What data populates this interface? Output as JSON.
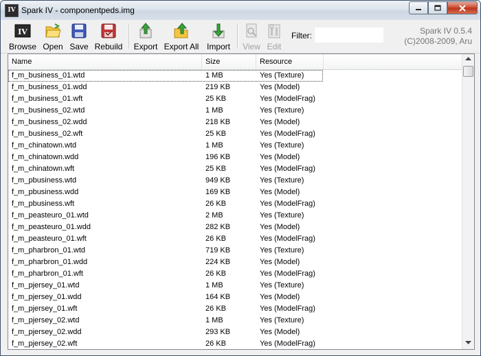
{
  "window": {
    "title": "Spark IV - componentpeds.img",
    "app_icon_text": "IV"
  },
  "toolbar": {
    "browse": "Browse",
    "open": "Open",
    "save": "Save",
    "rebuild": "Rebuild",
    "export": "Export",
    "export_all": "Export All",
    "import": "Import",
    "view": "View",
    "edit": "Edit",
    "filter_label": "Filter:",
    "filter_value": "",
    "version_line1": "Spark IV 0.5.4",
    "version_line2": "(C)2008-2009, Aru"
  },
  "columns": {
    "name": "Name",
    "size": "Size",
    "resource": "Resource"
  },
  "rows": [
    {
      "name": "f_m_business_01.wtd",
      "size": "1 MB",
      "resource": "Yes (Texture)"
    },
    {
      "name": "f_m_business_01.wdd",
      "size": "219 KB",
      "resource": "Yes (Model)"
    },
    {
      "name": "f_m_business_01.wft",
      "size": "25 KB",
      "resource": "Yes (ModelFrag)"
    },
    {
      "name": "f_m_business_02.wtd",
      "size": "1 MB",
      "resource": "Yes (Texture)"
    },
    {
      "name": "f_m_business_02.wdd",
      "size": "218 KB",
      "resource": "Yes (Model)"
    },
    {
      "name": "f_m_business_02.wft",
      "size": "25 KB",
      "resource": "Yes (ModelFrag)"
    },
    {
      "name": "f_m_chinatown.wtd",
      "size": "1 MB",
      "resource": "Yes (Texture)"
    },
    {
      "name": "f_m_chinatown.wdd",
      "size": "196 KB",
      "resource": "Yes (Model)"
    },
    {
      "name": "f_m_chinatown.wft",
      "size": "25 KB",
      "resource": "Yes (ModelFrag)"
    },
    {
      "name": "f_m_pbusiness.wtd",
      "size": "949 KB",
      "resource": "Yes (Texture)"
    },
    {
      "name": "f_m_pbusiness.wdd",
      "size": "169 KB",
      "resource": "Yes (Model)"
    },
    {
      "name": "f_m_pbusiness.wft",
      "size": "26 KB",
      "resource": "Yes (ModelFrag)"
    },
    {
      "name": "f_m_peasteuro_01.wtd",
      "size": "2 MB",
      "resource": "Yes (Texture)"
    },
    {
      "name": "f_m_peasteuro_01.wdd",
      "size": "282 KB",
      "resource": "Yes (Model)"
    },
    {
      "name": "f_m_peasteuro_01.wft",
      "size": "26 KB",
      "resource": "Yes (ModelFrag)"
    },
    {
      "name": "f_m_pharbron_01.wtd",
      "size": "719 KB",
      "resource": "Yes (Texture)"
    },
    {
      "name": "f_m_pharbron_01.wdd",
      "size": "224 KB",
      "resource": "Yes (Model)"
    },
    {
      "name": "f_m_pharbron_01.wft",
      "size": "26 KB",
      "resource": "Yes (ModelFrag)"
    },
    {
      "name": "f_m_pjersey_01.wtd",
      "size": "1 MB",
      "resource": "Yes (Texture)"
    },
    {
      "name": "f_m_pjersey_01.wdd",
      "size": "164 KB",
      "resource": "Yes (Model)"
    },
    {
      "name": "f_m_pjersey_01.wft",
      "size": "26 KB",
      "resource": "Yes (ModelFrag)"
    },
    {
      "name": "f_m_pjersey_02.wtd",
      "size": "1 MB",
      "resource": "Yes (Texture)"
    },
    {
      "name": "f_m_pjersey_02.wdd",
      "size": "293 KB",
      "resource": "Yes (Model)"
    },
    {
      "name": "f_m_pjersey_02.wft",
      "size": "26 KB",
      "resource": "Yes (ModelFrag)"
    }
  ]
}
